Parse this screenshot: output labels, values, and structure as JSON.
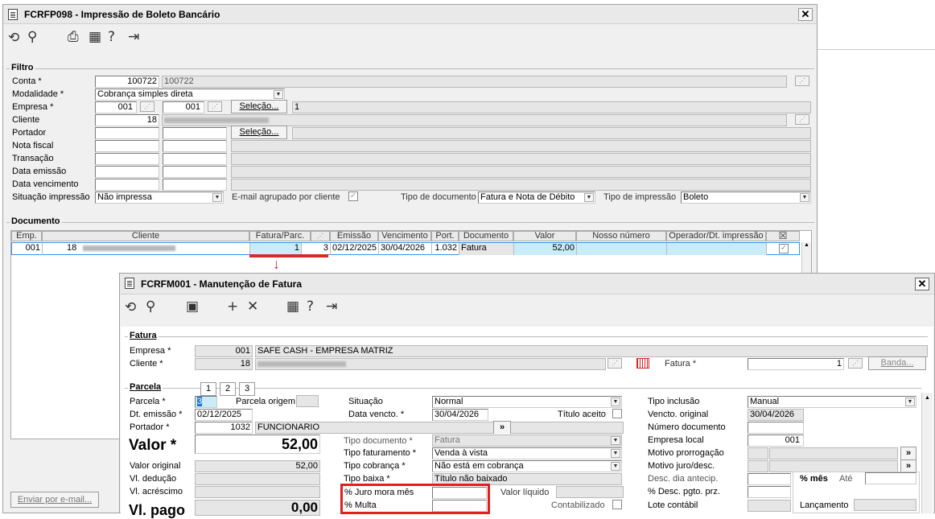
{
  "win1": {
    "title": "FCRFP098 - Impressão de Boleto Bancário",
    "close": "✕"
  },
  "filtro": {
    "legend": "Filtro",
    "conta_label": "Conta *",
    "conta_code": "100722",
    "conta_desc": "100722",
    "modalidade_label": "Modalidade *",
    "modalidade_value": "Cobrança simples direta",
    "empresa_label": "Empresa *",
    "empresa_from": "001",
    "empresa_to": "001",
    "selecao_label": "Seleção...",
    "empresa_desc": "1",
    "cliente_label": "Cliente",
    "cliente_code": "18",
    "portador_label": "Portador",
    "portador_selecao": "Seleção...",
    "nota_label": "Nota fiscal",
    "transacao_label": "Transação",
    "emissao_label": "Data emissão",
    "vencimento_label": "Data vencimento",
    "situacao_label": "Situação impressão",
    "situacao_value": "Não impressa",
    "email_label": "E-mail agrupado por cliente",
    "tipo_doc_label": "Tipo de documento",
    "tipo_doc_value": "Fatura e Nota de Débito",
    "tipo_imp_label": "Tipo de impressão",
    "tipo_imp_value": "Boleto"
  },
  "documento": {
    "legend": "Documento",
    "headers": [
      "Emp.",
      "Cliente",
      "Fatura/Parc.",
      "Emissão",
      "Vencimento",
      "Port.",
      "Documento",
      "Valor",
      "Nosso número",
      "Operador/Dt. impressão"
    ],
    "row": {
      "emp": "001",
      "cliente": "18",
      "fatura": "1",
      "parc": "3",
      "emissao": "02/12/2025",
      "vencimento": "30/04/2026",
      "port": "1.032",
      "documento": "Fatura",
      "valor": "52,00"
    }
  },
  "email_btn": "Enviar por e-mail...",
  "win2": {
    "title": "FCRFM001 - Manutenção de Fatura",
    "close": "✕"
  },
  "fatura": {
    "legend": "Fatura",
    "empresa_label": "Empresa *",
    "empresa_code": "001",
    "empresa_name": "SAFE CASH - EMPRESA MATRIZ",
    "cliente_label": "Cliente *",
    "cliente_code": "18",
    "fatura_label": "Fatura *",
    "fatura_value": "1",
    "banda_label": "Banda..."
  },
  "parcela": {
    "legend": "Parcela",
    "tabs": [
      "1",
      "2",
      "3"
    ],
    "parcela_label": "Parcela *",
    "parcela_value": "3",
    "parcela_origem_label": "Parcela origem",
    "emissao_label": "Dt. emissão *",
    "emissao_value": "02/12/2025",
    "portador_label": "Portador *",
    "portador_code": "1032",
    "portador_name": "FUNCIONARIO",
    "valor_label": "Valor *",
    "valor_value": "52,00",
    "valor_original_label": "Valor original",
    "valor_original_value": "52,00",
    "deducao_label": "Vl. dedução",
    "acrescimo_label": "Vl. acréscimo",
    "pago_label": "Vl. pago",
    "pago_value": "0,00",
    "situacao_label": "Situação",
    "situacao_value": "Normal",
    "vencto_label": "Data vencto. *",
    "vencto_value": "30/04/2026",
    "titulo_aceito_label": "Título aceito",
    "tipo_documento_label": "Tipo documento *",
    "tipo_documento_value": "Fatura",
    "tipo_faturamento_label": "Tipo faturamento *",
    "tipo_faturamento_value": "Venda à vista",
    "tipo_cobranca_label": "Tipo cobrança *",
    "tipo_cobranca_value": "Não está em cobrança",
    "tipo_baixa_label": "Tipo baixa *",
    "tipo_baixa_value": "Título não baixado",
    "juro_label": "% Juro mora mês",
    "multa_label": "% Multa",
    "valor_liquido_label": "Valor líquido",
    "contabilizado_label": "Contabilizado",
    "tipo_inclusao_label": "Tipo inclusão",
    "tipo_inclusao_value": "Manual",
    "vencto_original_label": "Vencto. original",
    "vencto_original_value": "30/04/2026",
    "numero_doc_label": "Número documento",
    "empresa_local_label": "Empresa local",
    "empresa_local_value": "001",
    "motivo_prorrog_label": "Motivo prorrogação",
    "motivo_juro_label": "Motivo juro/desc.",
    "desc_dia_label": "Desc. dia antecip.",
    "desc_pgto_label": "% Desc. pgto. prz.",
    "lote_label": "Lote contábil",
    "pct_mes_label": "% mês",
    "ate_label": "Até",
    "lancamento_label": "Lançamento"
  },
  "colors": {
    "highlight_red": "#e02020",
    "selected_row": "#c8ecf8",
    "arrow_red": "#d42a2a"
  }
}
